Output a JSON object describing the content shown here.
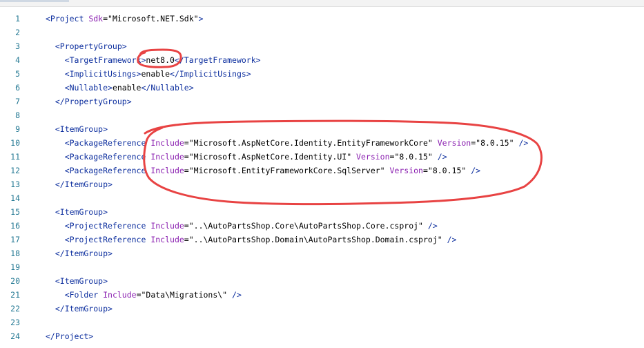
{
  "editor": {
    "line_numbers": [
      "1",
      "2",
      "3",
      "4",
      "5",
      "6",
      "7",
      "8",
      "9",
      "10",
      "11",
      "12",
      "13",
      "14",
      "15",
      "16",
      "17",
      "18",
      "19",
      "20",
      "21",
      "22",
      "23",
      "24"
    ],
    "lines": [
      [
        {
          "c": "t",
          "s": "<Project "
        },
        {
          "c": "a",
          "s": "Sdk"
        },
        {
          "c": "v",
          "s": "=\"Microsoft.NET.Sdk\""
        },
        {
          "c": "t",
          "s": ">"
        }
      ],
      [],
      [
        {
          "c": "t",
          "s": "  <PropertyGroup>"
        }
      ],
      [
        {
          "c": "t",
          "s": "    <TargetFramework>"
        },
        {
          "c": "x",
          "s": "net8.0"
        },
        {
          "c": "t",
          "s": "</TargetFramework>"
        }
      ],
      [
        {
          "c": "t",
          "s": "    <ImplicitUsings>"
        },
        {
          "c": "x",
          "s": "enable"
        },
        {
          "c": "t",
          "s": "</ImplicitUsings>"
        }
      ],
      [
        {
          "c": "t",
          "s": "    <Nullable>"
        },
        {
          "c": "x",
          "s": "enable"
        },
        {
          "c": "t",
          "s": "</Nullable>"
        }
      ],
      [
        {
          "c": "t",
          "s": "  </PropertyGroup>"
        }
      ],
      [],
      [
        {
          "c": "t",
          "s": "  <ItemGroup>"
        }
      ],
      [
        {
          "c": "t",
          "s": "    <PackageReference "
        },
        {
          "c": "a",
          "s": "Include"
        },
        {
          "c": "v",
          "s": "=\"Microsoft.AspNetCore.Identity.EntityFrameworkCore\" "
        },
        {
          "c": "a",
          "s": "Version"
        },
        {
          "c": "v",
          "s": "=\"8.0.15\" "
        },
        {
          "c": "t",
          "s": "/>"
        }
      ],
      [
        {
          "c": "t",
          "s": "    <PackageReference "
        },
        {
          "c": "a",
          "s": "Include"
        },
        {
          "c": "v",
          "s": "=\"Microsoft.AspNetCore.Identity.UI\" "
        },
        {
          "c": "a",
          "s": "Version"
        },
        {
          "c": "v",
          "s": "=\"8.0.15\" "
        },
        {
          "c": "t",
          "s": "/>"
        }
      ],
      [
        {
          "c": "t",
          "s": "    <PackageReference "
        },
        {
          "c": "a",
          "s": "Include"
        },
        {
          "c": "v",
          "s": "=\"Microsoft.EntityFrameworkCore.SqlServer\" "
        },
        {
          "c": "a",
          "s": "Version"
        },
        {
          "c": "v",
          "s": "=\"8.0.15\" "
        },
        {
          "c": "t",
          "s": "/>"
        }
      ],
      [
        {
          "c": "t",
          "s": "  </ItemGroup>"
        }
      ],
      [],
      [
        {
          "c": "t",
          "s": "  <ItemGroup>"
        }
      ],
      [
        {
          "c": "t",
          "s": "    <ProjectReference "
        },
        {
          "c": "a",
          "s": "Include"
        },
        {
          "c": "v",
          "s": "=\"..\\AutoPartsShop.Core\\AutoPartsShop.Core.csproj\" "
        },
        {
          "c": "t",
          "s": "/>"
        }
      ],
      [
        {
          "c": "t",
          "s": "    <ProjectReference "
        },
        {
          "c": "a",
          "s": "Include"
        },
        {
          "c": "v",
          "s": "=\"..\\AutoPartsShop.Domain\\AutoPartsShop.Domain.csproj\" "
        },
        {
          "c": "t",
          "s": "/>"
        }
      ],
      [
        {
          "c": "t",
          "s": "  </ItemGroup>"
        }
      ],
      [],
      [
        {
          "c": "t",
          "s": "  <ItemGroup>"
        }
      ],
      [
        {
          "c": "t",
          "s": "    <Folder "
        },
        {
          "c": "a",
          "s": "Include"
        },
        {
          "c": "v",
          "s": "=\"Data\\Migrations\\\" "
        },
        {
          "c": "t",
          "s": "/>"
        }
      ],
      [
        {
          "c": "t",
          "s": "  </ItemGroup>"
        }
      ],
      [],
      [
        {
          "c": "t",
          "s": "</Project>"
        }
      ]
    ]
  },
  "colors": {
    "tag": "#0c2e9e",
    "attribute": "#8a1fb0",
    "value": "#000000",
    "line_number": "#237893",
    "annotation": "#e84343"
  }
}
